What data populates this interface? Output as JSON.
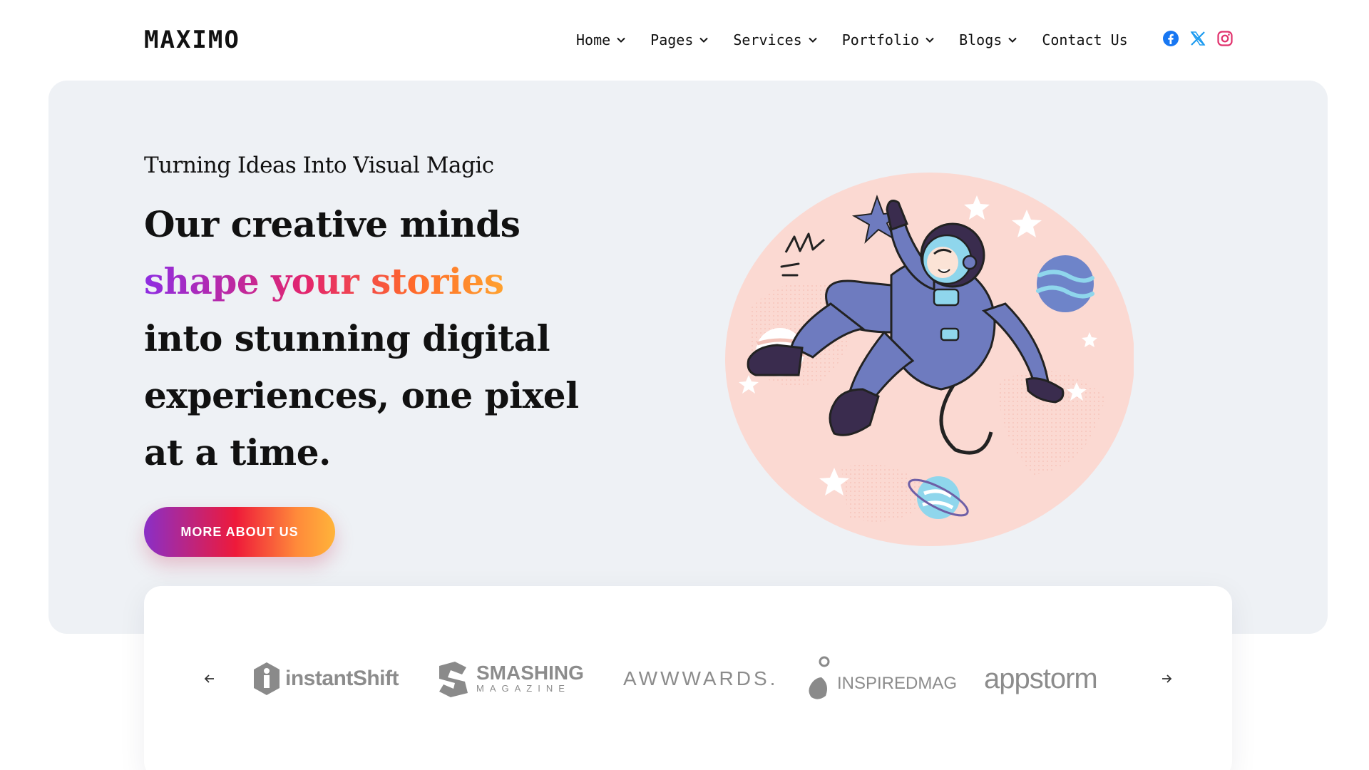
{
  "header": {
    "logo": "MAXIMO",
    "nav": [
      {
        "label": "Home",
        "dropdown": true
      },
      {
        "label": "Pages",
        "dropdown": true
      },
      {
        "label": "Services",
        "dropdown": true
      },
      {
        "label": "Portfolio",
        "dropdown": true
      },
      {
        "label": "Blogs",
        "dropdown": true
      },
      {
        "label": "Contact Us",
        "dropdown": false
      }
    ],
    "socials": [
      "facebook-icon",
      "x-twitter-icon",
      "instagram-icon"
    ],
    "colors": {
      "facebook": "#1877f2",
      "x": "#1d9bf0",
      "instagram": "#e1306c"
    }
  },
  "hero": {
    "tagline": "Turning Ideas Into Visual Magic",
    "headline_start": "Our creative minds",
    "headline_gradient": "shape your stories",
    "headline_end": "into stunning digital experiences, one pixel at a time.",
    "cta_label": "MORE ABOUT US",
    "background": "#eef1f5",
    "illustration": "astronaut-floating-in-space"
  },
  "brands": {
    "items": [
      {
        "name": "instantShift"
      },
      {
        "name": "SMASHING",
        "sub": "MAGAZINE"
      },
      {
        "name": "AWWWARDS."
      },
      {
        "name": "INSPIREDMAG"
      },
      {
        "name": "appstorm"
      }
    ]
  }
}
